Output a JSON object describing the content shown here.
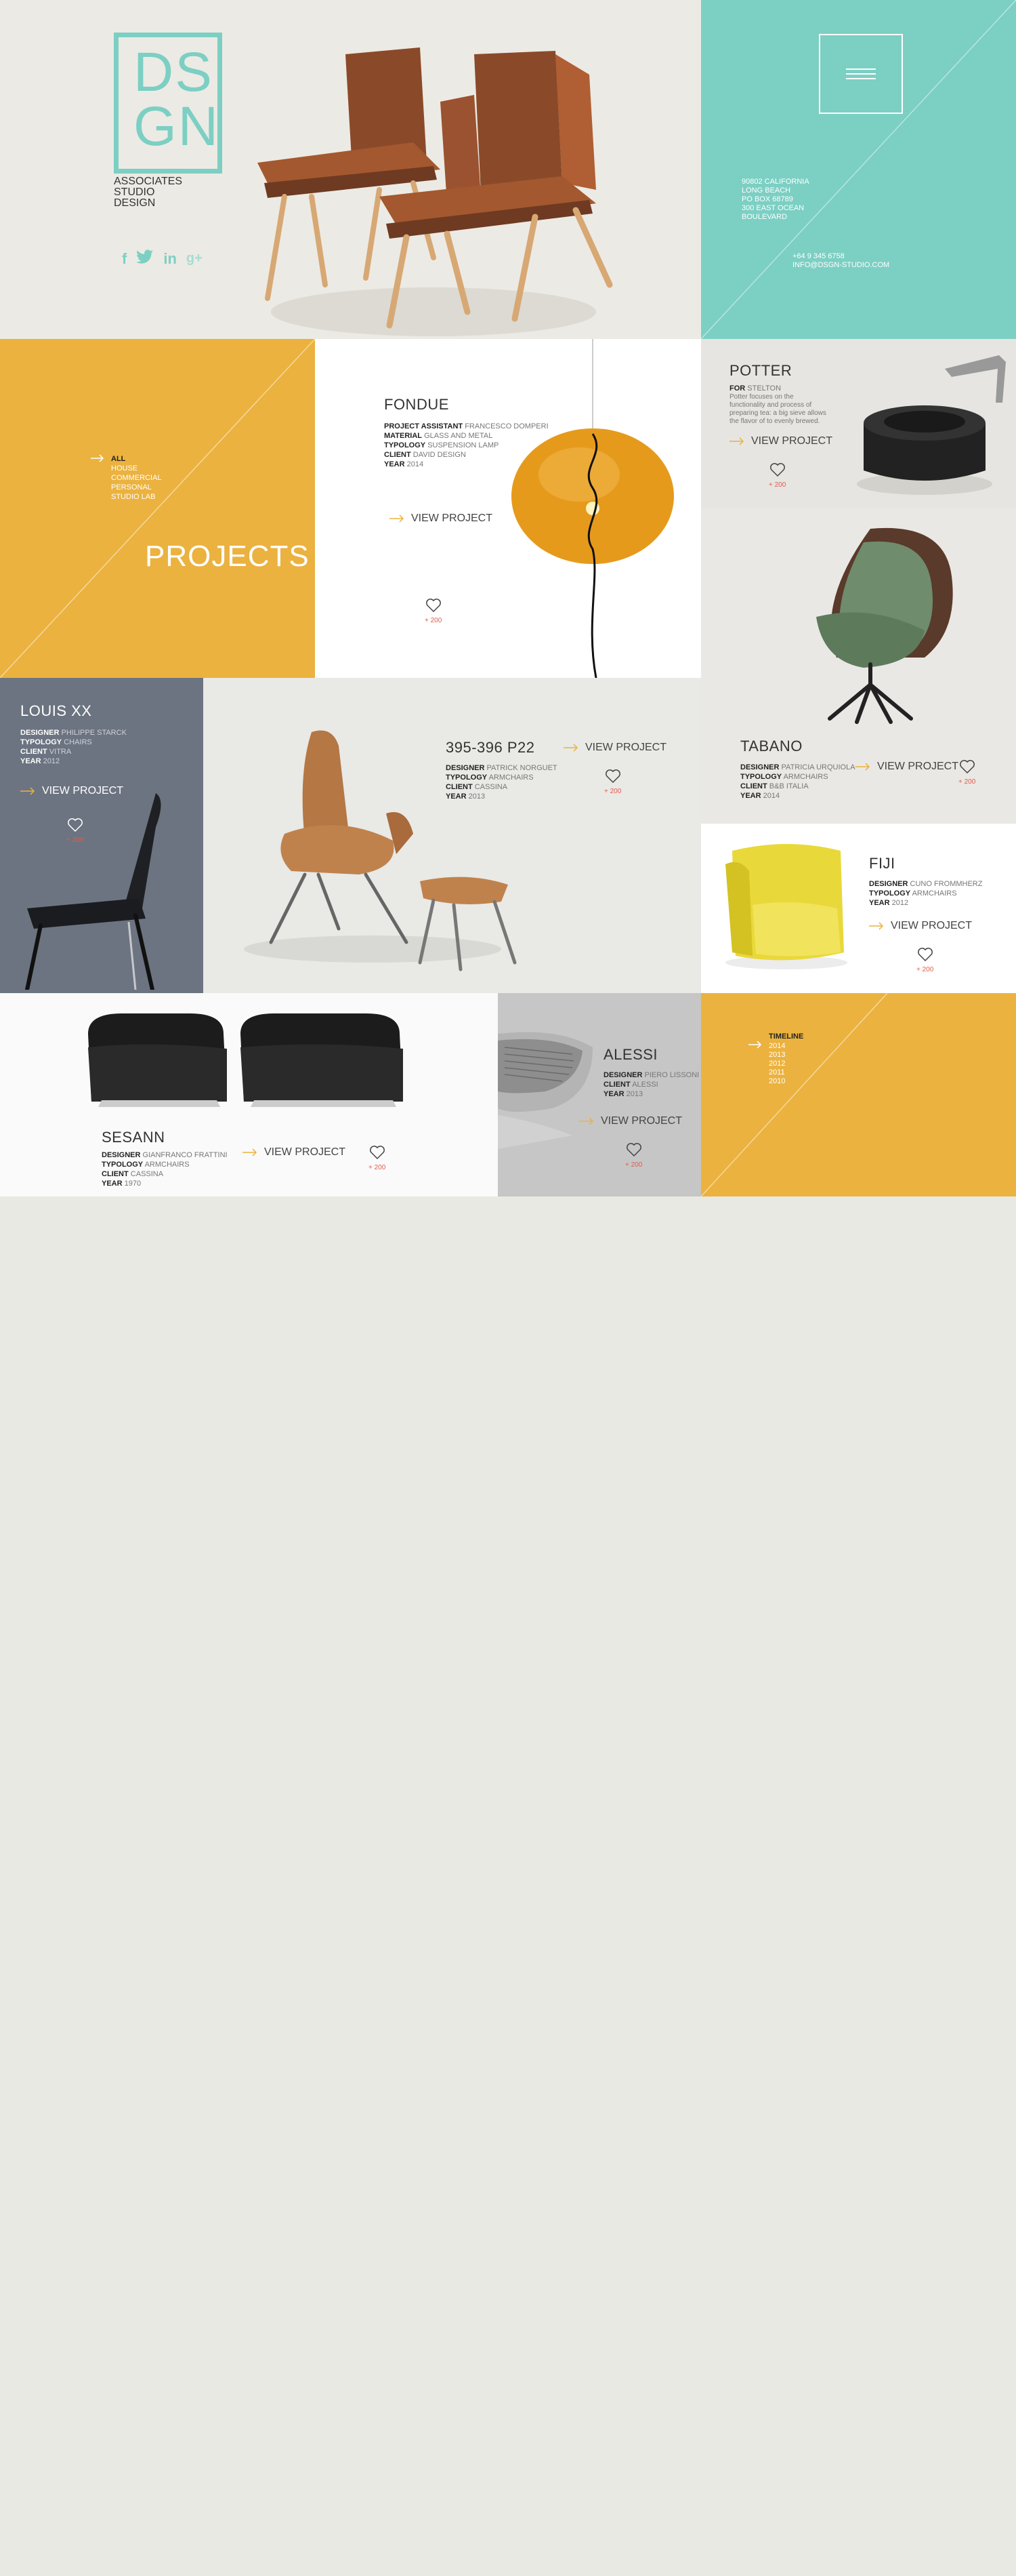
{
  "brand": {
    "logo_letters": [
      "D",
      "S",
      "G",
      "N"
    ],
    "tagline_lines": [
      "ASSOCIATES",
      "STUDIO",
      "DESIGN"
    ],
    "color": "#7ccfc3"
  },
  "social": [
    {
      "icon": "facebook-icon",
      "glyph": "f"
    },
    {
      "icon": "twitter-icon",
      "glyph": "🐦"
    },
    {
      "icon": "linkedin-icon",
      "glyph": "in"
    },
    {
      "icon": "googleplus-icon",
      "glyph": "g+"
    }
  ],
  "contact": {
    "address_lines": [
      "90802 CALIFORNIA",
      "LONG BEACH",
      "PO BOX 68789",
      "300 EAST OCEAN",
      "BOULEVARD"
    ],
    "phone": "+64 9 345 6758",
    "email": "INFO@DSGN-STUDIO.COM"
  },
  "projects_panel": {
    "heading": "PROJECTS",
    "filters": [
      "ALL",
      "HOUSE",
      "COMMERCIAL",
      "PERSONAL",
      "STUDIO LAB"
    ],
    "active_filter": "ALL"
  },
  "view_label": "VIEW PROJECT",
  "projects": {
    "fondue": {
      "title": "FONDUE",
      "meta": [
        {
          "k": "PROJECT ASSISTANT",
          "v": "FRANCESCO DOMPERI"
        },
        {
          "k": "MATERIAL",
          "v": "GLASS AND METAL"
        },
        {
          "k": "TYPOLOGY",
          "v": "SUSPENSION LAMP"
        },
        {
          "k": "CLIENT",
          "v": "DAVID DESIGN"
        },
        {
          "k": "YEAR",
          "v": "2014"
        }
      ],
      "likes": "+ 200"
    },
    "potter": {
      "title": "POTTER",
      "meta": [
        {
          "k": "FOR",
          "v": "STELTON"
        }
      ],
      "description": "Potter focuses on the functionality and process of preparing tea: a big sieve allows the flavor of to evenly brewed.",
      "likes": "+ 200"
    },
    "louis": {
      "title": "LOUIS XX",
      "meta": [
        {
          "k": "DESIGNER",
          "v": "PHILIPPE STARCK"
        },
        {
          "k": "TYPOLOGY",
          "v": "CHAIRS"
        },
        {
          "k": "CLIENT",
          "v": "VITRA"
        },
        {
          "k": "YEAR",
          "v": "2012"
        }
      ],
      "likes": "+ 200"
    },
    "p22": {
      "title": "395-396 P22",
      "meta": [
        {
          "k": "DESIGNER",
          "v": "PATRICK NORGUET"
        },
        {
          "k": "TYPOLOGY",
          "v": "ARMCHAIRS"
        },
        {
          "k": "CLIENT",
          "v": "CASSINA"
        },
        {
          "k": "YEAR",
          "v": "2013"
        }
      ],
      "likes": "+ 200"
    },
    "tabano": {
      "title": "TABANO",
      "meta": [
        {
          "k": "DESIGNER",
          "v": "PATRICIA URQUIOLA"
        },
        {
          "k": "TYPOLOGY",
          "v": "ARMCHAIRS"
        },
        {
          "k": "CLIENT",
          "v": "B&B ITALIA"
        },
        {
          "k": "YEAR",
          "v": "2014"
        }
      ],
      "likes": "+ 200"
    },
    "fiji": {
      "title": "FIJI",
      "meta": [
        {
          "k": "DESIGNER",
          "v": "CUNO FROMMHERZ"
        },
        {
          "k": "TYPOLOGY",
          "v": "ARMCHAIRS"
        },
        {
          "k": "YEAR",
          "v": "2012"
        }
      ],
      "likes": "+ 200"
    },
    "sesann": {
      "title": "SESANN",
      "meta": [
        {
          "k": "DESIGNER",
          "v": "GIANFRANCO FRATTINI"
        },
        {
          "k": "TYPOLOGY",
          "v": "ARMCHAIRS"
        },
        {
          "k": "CLIENT",
          "v": "CASSINA"
        },
        {
          "k": "YEAR",
          "v": "1970"
        }
      ],
      "likes": "+ 200"
    },
    "alessi": {
      "title": "ALESSI",
      "meta": [
        {
          "k": "DESIGNER",
          "v": "PIERO LISSONI"
        },
        {
          "k": "CLIENT",
          "v": "ALESSI"
        },
        {
          "k": "YEAR",
          "v": "2013"
        }
      ],
      "likes": "+ 200"
    }
  },
  "timeline": {
    "label": "TIMELINE",
    "years": [
      "2014",
      "2013",
      "2012",
      "2011",
      "2010"
    ]
  },
  "colors": {
    "teal": "#7ccfc3",
    "mustard": "#ebb23f",
    "slate": "#6c7481",
    "light_gray": "#e9e9e6",
    "white": "#ffffff",
    "accent_arrow": "#ebb23f",
    "like_red": "#e25b4b"
  }
}
